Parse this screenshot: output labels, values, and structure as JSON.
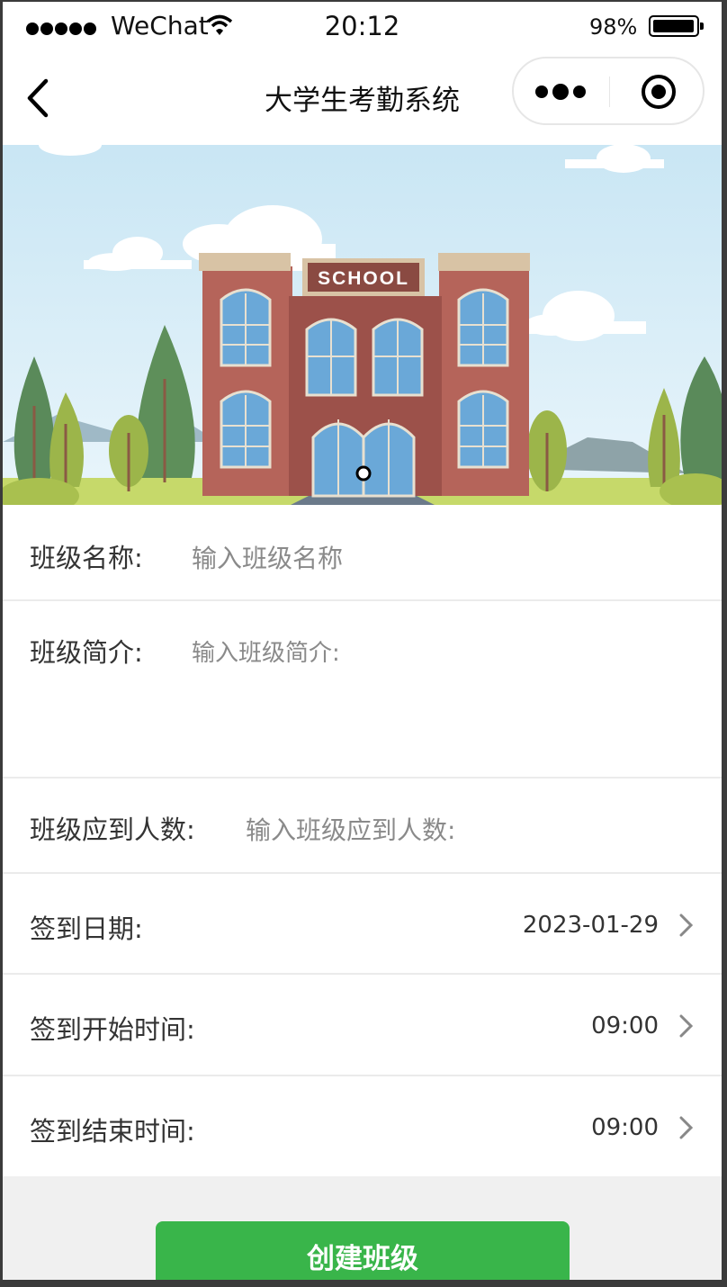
{
  "status_bar": {
    "carrier": "WeChat",
    "time": "20:12",
    "battery": "98%"
  },
  "navbar": {
    "title": "大学生考勤系统"
  },
  "banner": {
    "sign": "SCHOOL"
  },
  "form": {
    "class_name": {
      "label": "班级名称:",
      "placeholder": "输入班级名称"
    },
    "class_intro": {
      "label": "班级简介:",
      "placeholder": "输入班级简介:"
    },
    "expected_count": {
      "label": "班级应到人数:",
      "placeholder": "输入班级应到人数:"
    },
    "checkin_date": {
      "label": "签到日期:",
      "value": "2023-01-29"
    },
    "start_time": {
      "label": "签到开始时间:",
      "value": "09:00"
    },
    "end_time": {
      "label": "签到结束时间:",
      "value": "09:00"
    }
  },
  "actions": {
    "create_label": "创建班级"
  },
  "colors": {
    "accent": "#39b54a"
  }
}
